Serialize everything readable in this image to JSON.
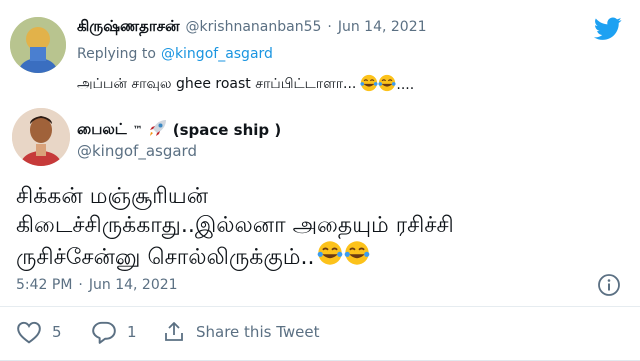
{
  "colors": {
    "accent": "#1da1f2",
    "muted": "#5b7083",
    "text": "#0f1419",
    "divider": "#e6ecf0",
    "link": "#1b95e0"
  },
  "reply_tweet": {
    "display_name": "கிருஷ்ணதாசன்",
    "handle": "@krishnananban55",
    "separator": "·",
    "date": "Jun 14, 2021",
    "replying_to_label": "Replying to",
    "replying_to_handle": "@kingof_asgard",
    "text_before": "அப்பன் சாவுல ghee roast சாப்பிட்டாளா...",
    "text_after": "...."
  },
  "main_tweet": {
    "display_name": "பைலட்",
    "display_name_tm": "™",
    "display_name_suffix": "(space ship )",
    "handle": "@kingof_asgard",
    "line1": "சிக்கன் மஞ்சூரியன்",
    "line2": "கிடைச்சிருக்காது..இல்லனா  அதையும் ரசிச்சி",
    "line3": "ருசிச்சேன்னு சொல்லிருக்கும்..",
    "time": "5:42 PM",
    "separator": "·",
    "date": "Jun 14, 2021"
  },
  "actions": {
    "like_count": "5",
    "reply_count": "1",
    "share_label": "Share this Tweet"
  },
  "icons": [
    "twitter-bird-icon",
    "info-icon",
    "heart-icon",
    "reply-icon",
    "share-icon",
    "rocket-emoji",
    "joy-emoji"
  ]
}
